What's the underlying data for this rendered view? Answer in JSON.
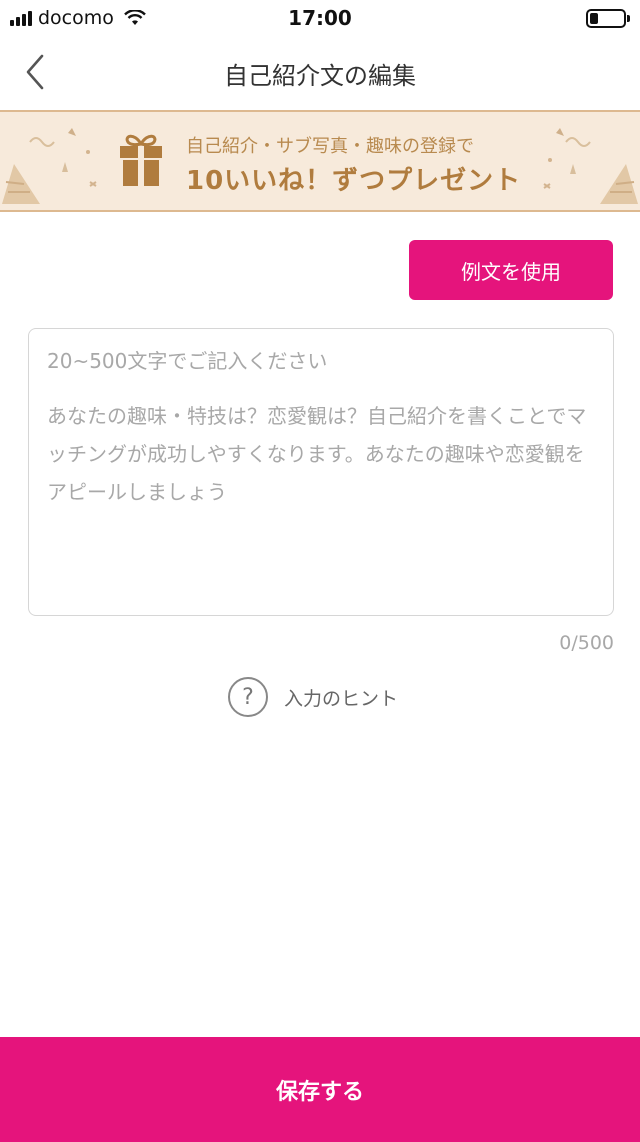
{
  "status_bar": {
    "carrier": "docomo",
    "time": "17:00",
    "battery_level": 0.25
  },
  "nav": {
    "title": "自己紹介文の編集"
  },
  "promo": {
    "line1": "自己紹介・サブ写真・趣味の登録で",
    "line2": "10いいね！ずつプレゼント"
  },
  "actions": {
    "example_label": "例文を使用",
    "save_label": "保存する"
  },
  "editor": {
    "value": "",
    "placeholder_head": "20~500文字でご記入ください",
    "placeholder_body": "あなたの趣味・特技は？恋愛観は？自己紹介を書くことでマッチングが成功しやすくなります。あなたの趣味や恋愛観をアピールしましょう",
    "char_count": "0/500"
  },
  "hint": {
    "icon_glyph": "?",
    "label": "入力のヒント"
  },
  "colors": {
    "accent": "#e5147c",
    "banner_bg": "#f7eadb",
    "banner_text": "#b07c3e"
  }
}
